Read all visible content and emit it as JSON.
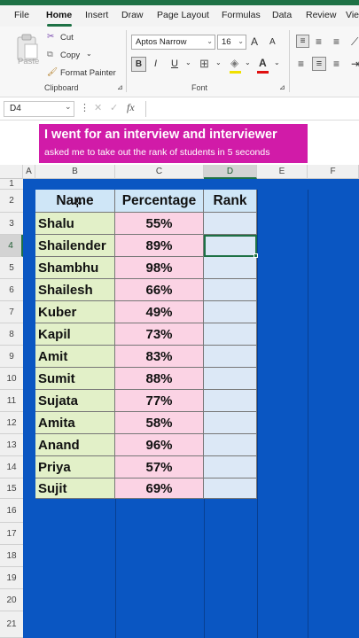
{
  "ribbon": {
    "tabs": [
      "File",
      "Home",
      "Insert",
      "Draw",
      "Page Layout",
      "Formulas",
      "Data",
      "Review",
      "Vie"
    ],
    "active_tab": "Home",
    "clipboard": {
      "paste_label": "Paste",
      "cut_label": "Cut",
      "copy_label": "Copy",
      "format_painter_label": "Format Painter",
      "group_label": "Clipboard"
    },
    "font": {
      "font_name": "Aptos Narrow",
      "font_size": "16",
      "bold": "B",
      "italic": "I",
      "underline": "U",
      "font_color_letter": "A",
      "grow": "A",
      "shrink": "A",
      "group_label": "Font"
    }
  },
  "formula_bar": {
    "name_box": "D4",
    "fx": "fx",
    "value": ""
  },
  "banner": {
    "line1": "I went for an interview and interviewer",
    "line2": "asked me to take out the rank of students in 5 seconds"
  },
  "sheet": {
    "columns": [
      "A",
      "B",
      "C",
      "D",
      "E",
      "F"
    ],
    "selected_cell": "D4",
    "row_numbers": [
      "1",
      "2",
      "3",
      "4",
      "5",
      "6",
      "7",
      "8",
      "9",
      "10",
      "11",
      "12",
      "13",
      "14",
      "15",
      "16",
      "17",
      "18",
      "19",
      "20",
      "21"
    ],
    "header": {
      "name": "Name",
      "percentage": "Percentage",
      "rank": "Rank"
    },
    "rows": [
      {
        "name": "Shalu",
        "percentage": "55%",
        "rank": ""
      },
      {
        "name": "Shailender",
        "percentage": "89%",
        "rank": ""
      },
      {
        "name": "Shambhu",
        "percentage": "98%",
        "rank": ""
      },
      {
        "name": "Shailesh",
        "percentage": "66%",
        "rank": ""
      },
      {
        "name": "Kuber",
        "percentage": "49%",
        "rank": ""
      },
      {
        "name": "Kapil",
        "percentage": "73%",
        "rank": ""
      },
      {
        "name": "Amit",
        "percentage": "83%",
        "rank": ""
      },
      {
        "name": "Sumit",
        "percentage": "88%",
        "rank": ""
      },
      {
        "name": "Sujata",
        "percentage": "77%",
        "rank": ""
      },
      {
        "name": "Amita",
        "percentage": "58%",
        "rank": ""
      },
      {
        "name": "Anand",
        "percentage": "96%",
        "rank": ""
      },
      {
        "name": "Priya",
        "percentage": "57%",
        "rank": ""
      },
      {
        "name": "Sujit",
        "percentage": "69%",
        "rank": ""
      }
    ]
  },
  "colors": {
    "excel_green": "#1e7145",
    "banner_magenta": "#d11ba8",
    "sheet_blue": "#0a56c2",
    "name_fill": "#e2f0c8",
    "pct_fill": "#fbd3e4",
    "rank_fill": "#dce8f6",
    "header_fill": "#cfe6f7"
  }
}
